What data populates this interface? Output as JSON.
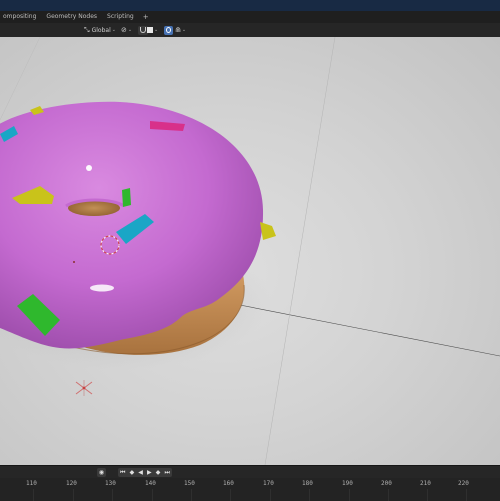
{
  "workspace_tabs": [
    "ompositing",
    "Geometry Nodes",
    "Scripting"
  ],
  "add_tab": "+",
  "header": {
    "transform_orientation": "Global",
    "orientation_icon": "axes-icon",
    "pivot_icon": "pivot-icon",
    "snap_icon": "magnet-icon",
    "proportional_icon": "falloff-icon"
  },
  "timeline": {
    "frames": [
      "110",
      "120",
      "130",
      "140",
      "150",
      "160",
      "170",
      "180",
      "190",
      "200",
      "210",
      "220"
    ]
  },
  "colors": {
    "frosting": "#c46ad0",
    "dough": "#c9935a",
    "sprinkle_cyan": "#1aa6c6",
    "sprinkle_yellow": "#c9c31a",
    "sprinkle_green": "#2fb82d",
    "sprinkle_pink": "#d8308a",
    "accent": "#4772b3"
  }
}
